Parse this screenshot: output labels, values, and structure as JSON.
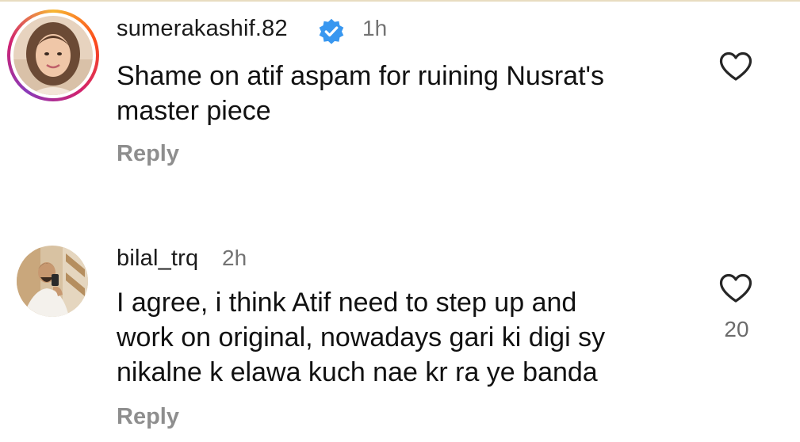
{
  "comments": [
    {
      "username": "sumerakashif.82",
      "verified": true,
      "time": "1h",
      "text_lines": [
        "Shame on atif aspam for ruining Nusrat's",
        "master piece"
      ],
      "reply_label": "Reply",
      "like_count": ""
    },
    {
      "username": "bilal_trq",
      "verified": false,
      "time": "2h",
      "text_lines": [
        "I agree, i think Atif need to step up and",
        "work on original, nowadays gari ki digi sy",
        "nikalne k elawa kuch nae kr ra ye banda"
      ],
      "reply_label": "Reply",
      "like_count": "20"
    }
  ],
  "icons": {
    "like": "heart-outline-icon",
    "verified": "verified-badge-icon"
  },
  "colors": {
    "verified_blue": "#3897f0",
    "secondary_text": "#737373",
    "reply_text": "#8e8e8e"
  }
}
